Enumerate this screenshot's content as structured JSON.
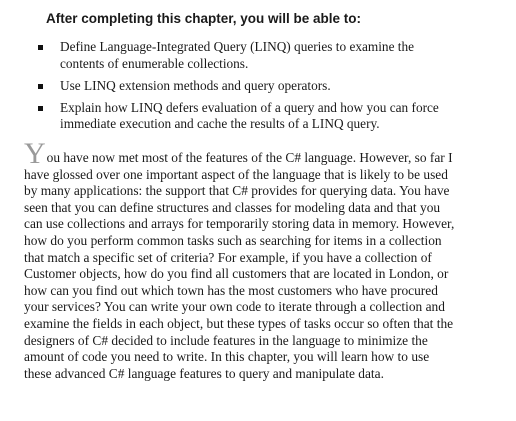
{
  "heading": "After completing this chapter, you will be able to:",
  "objectives": [
    {
      "lines": [
        "Define Language-Integrated Query (LINQ) queries to examine the",
        "contents of enumerable collections."
      ]
    },
    {
      "lines": [
        "Use LINQ extension methods and query operators."
      ]
    },
    {
      "lines": [
        "Explain how LINQ defers evaluation of a query and how you can force",
        "immediate execution and cache the results of a LINQ query."
      ]
    }
  ],
  "body": {
    "drop_cap": "Y",
    "first_line_rest": "ou have now met most of the features of the C# language. However, so far I",
    "lines": [
      "have glossed over one important aspect of the language that is likely to be used",
      "by many applications: the support that C# provides for querying data. You have",
      "seen that you can define structures and classes for modeling data and that you",
      "can use collections and arrays for temporarily storing data in memory. However,",
      "how do you perform common tasks such as searching for items in a collection",
      "that match a specific set of criteria? For example, if you have a collection of",
      "Customer objects, how do you find all customers that are located in London, or",
      "how can you find out which town has the most customers who have procured",
      "your services? You can write your own code to iterate through a collection and",
      "examine the fields in each object, but these types of tasks occur so often that the",
      "designers of C# decided to include features in the language to minimize the",
      "amount of code you need to write. In this chapter, you will learn how to use",
      "these advanced C# language features to query and manipulate data."
    ]
  }
}
